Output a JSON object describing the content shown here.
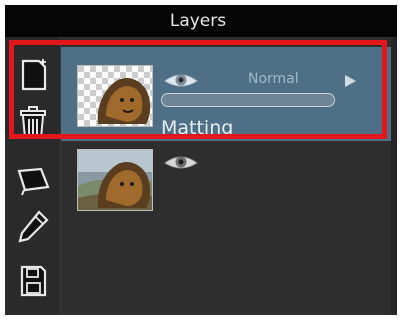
{
  "panel": {
    "title": "Layers"
  },
  "toolbar": {
    "tools": [
      {
        "icon": "new-layer-icon"
      },
      {
        "icon": "trash-icon"
      },
      {
        "icon": "tablet-icon"
      },
      {
        "icon": "pencil-icon"
      },
      {
        "icon": "save-icon"
      }
    ]
  },
  "layers": [
    {
      "name": "Matting",
      "blend_mode": "Normal",
      "visible": true,
      "selected": true
    },
    {
      "name": "",
      "visible": true,
      "selected": false
    }
  ],
  "colors": {
    "selected_row": "#4f6f86",
    "highlight": "#e3161b",
    "background": "#2d2d2d"
  }
}
